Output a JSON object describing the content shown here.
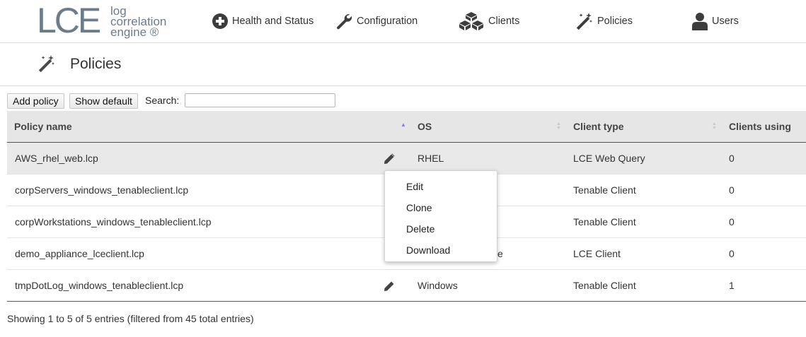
{
  "logo": {
    "big": "LCE",
    "line1": "log",
    "line2": "correlation",
    "line3": "engine ®"
  },
  "nav": [
    {
      "label": "Health and Status",
      "icon": "plus-circle-icon"
    },
    {
      "label": "Configuration",
      "icon": "wrench-icon"
    },
    {
      "label": "Clients",
      "icon": "cubes-icon"
    },
    {
      "label": "Policies",
      "icon": "magic-wand-icon"
    },
    {
      "label": "Users",
      "icon": "user-icon"
    }
  ],
  "page": {
    "title": "Policies",
    "icon": "magic-wand-icon"
  },
  "toolbar": {
    "add_label": "Add policy",
    "default_label": "Show default",
    "search_label": "Search:",
    "search_value": ""
  },
  "table": {
    "columns": [
      "Policy name",
      "OS",
      "Client type",
      "Clients using"
    ],
    "rows": [
      {
        "name": "AWS_rhel_web.lcp",
        "os": "RHEL",
        "client_type": "LCE Web Query",
        "clients": "0"
      },
      {
        "name": "corpServers_windows_tenableclient.lcp",
        "os": "",
        "client_type": "Tenable Client",
        "clients": "0"
      },
      {
        "name": "corpWorkstations_windows_tenableclient.lcp",
        "os": "",
        "client_type": "Tenable Client",
        "clients": "0"
      },
      {
        "name": "demo_appliance_lceclient.lcp",
        "os": "e",
        "client_type": "LCE Client",
        "clients": "0"
      },
      {
        "name": "tmpDotLog_windows_tenableclient.lcp",
        "os": "Windows",
        "client_type": "Tenable Client",
        "clients": "1"
      }
    ]
  },
  "menu": {
    "items": [
      "Edit",
      "Clone",
      "Delete",
      "Download"
    ]
  },
  "footer": {
    "info": "Showing 1 to 5 of 5 entries (filtered from 45 total entries)"
  },
  "colors": {
    "logo": "#6d7c8b",
    "header_bg": "#e6e6e6",
    "row_highlight": "#e9e9e9",
    "sort_active": "#7f7fe0"
  }
}
